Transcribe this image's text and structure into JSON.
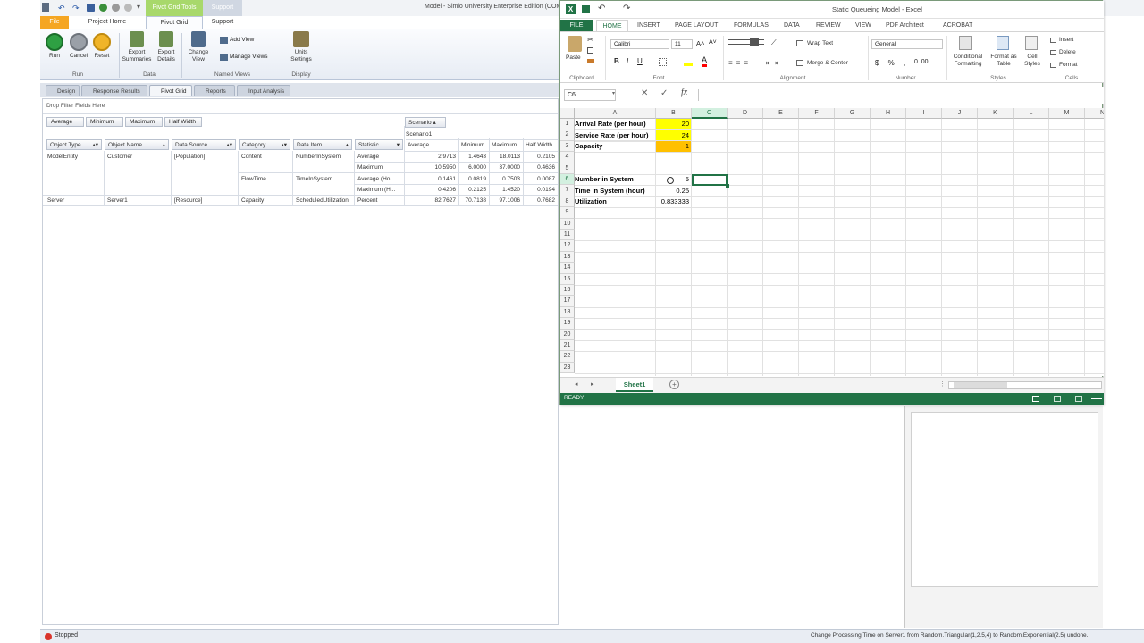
{
  "simio": {
    "window_title": "Model - Simio University Enterprise Edition (COMM",
    "tabs": [
      {
        "label": "File"
      },
      {
        "label": "Project Home"
      },
      {
        "label": "Pivot Grid"
      },
      {
        "label": "Support"
      }
    ],
    "context_tab": "Pivot Grid Tools",
    "context_tab2": "Support",
    "ribbon": {
      "run": {
        "label": "Run"
      },
      "cancel": {
        "label": "Cancel"
      },
      "reset": {
        "label": "Reset"
      },
      "run_group": "Run",
      "export_summaries": "Export Summaries",
      "export_details": "Export Details",
      "data_group": "Data",
      "change_view": "Change View",
      "add_view": "Add View",
      "manage_views": "Manage Views",
      "named_views_group": "Named Views",
      "units_settings": "Units Settings",
      "display_group": "Display"
    },
    "doc_tabs": [
      "Design",
      "Response Results",
      "Pivot Grid",
      "Reports",
      "Input Analysis"
    ],
    "pivot": {
      "drop_filter": "Drop Filter Fields Here",
      "stat_buttons": [
        "Average",
        "Minimum",
        "Maximum",
        "Half Width"
      ],
      "scenario_header": "Scenario",
      "scenario_name": "Scenario1",
      "row_headers": [
        "Object Type",
        "Object Name",
        "Data Source",
        "Category",
        "Data Item",
        "Statistic"
      ],
      "value_headers": [
        "Average",
        "Minimum",
        "Maximum",
        "Half Width"
      ],
      "rows": [
        {
          "object_type": "ModelEntity",
          "object_name": "Customer",
          "data_source": "[Population]",
          "category": "Content",
          "data_item": "NumberInSystem",
          "statistic": "Average",
          "values": [
            "2.9713",
            "1.4643",
            "18.0113",
            "0.2105"
          ]
        },
        {
          "object_type": "",
          "object_name": "",
          "data_source": "",
          "category": "",
          "data_item": "",
          "statistic": "Maximum",
          "values": [
            "10.5950",
            "6.0000",
            "37.0000",
            "0.4636"
          ]
        },
        {
          "object_type": "",
          "object_name": "",
          "data_source": "",
          "category": "FlowTime",
          "data_item": "TimeInSystem",
          "statistic": "Average (Ho...",
          "values": [
            "0.1461",
            "0.0819",
            "0.7503",
            "0.0087"
          ]
        },
        {
          "object_type": "",
          "object_name": "",
          "data_source": "",
          "category": "",
          "data_item": "",
          "statistic": "Maximum (H...",
          "values": [
            "0.4206",
            "0.2125",
            "1.4520",
            "0.0194"
          ]
        },
        {
          "object_type": "Server",
          "object_name": "Server1",
          "data_source": "[Resource]",
          "category": "Capacity",
          "data_item": "ScheduledUtilization",
          "statistic": "Percent",
          "values": [
            "82.7627",
            "70.7138",
            "97.1006",
            "0.7682"
          ]
        }
      ]
    },
    "status_left": "Stopped",
    "status_right": "Change Processing Time on Server1 from Random.Triangular(1,2.5,4) to Random.Exponential(2.5) undone."
  },
  "excel": {
    "title": "Static Queueing Model - Excel",
    "tabs": [
      "FILE",
      "HOME",
      "INSERT",
      "PAGE LAYOUT",
      "FORMULAS",
      "DATA",
      "REVIEW",
      "VIEW",
      "PDF Architect",
      "ACROBAT"
    ],
    "ribbon": {
      "paste": "Paste",
      "clipboard": "Clipboard",
      "font_name": "Calibri",
      "font_size": "11",
      "font_group": "Font",
      "wrap_text": "Wrap Text",
      "merge_center": "Merge & Center",
      "alignment_group": "Alignment",
      "number_format": "General",
      "number_group": "Number",
      "conditional_formatting": "Conditional Formatting",
      "format_as_table": "Format as Table",
      "cell_styles": "Cell Styles",
      "styles_group": "Styles",
      "insert": "Insert",
      "delete": "Delete",
      "format": "Format",
      "cells_group": "Cells"
    },
    "name_box": "C6",
    "formula": "",
    "columns": [
      "A",
      "B",
      "C",
      "D",
      "E",
      "F",
      "G",
      "H",
      "I",
      "J",
      "K",
      "L",
      "M",
      "N"
    ],
    "row_numbers": [
      "1",
      "2",
      "3",
      "4",
      "5",
      "6",
      "7",
      "8",
      "9",
      "10",
      "11",
      "12",
      "13",
      "14",
      "15",
      "16",
      "17",
      "18",
      "19",
      "20",
      "21",
      "22",
      "23"
    ],
    "cells": {
      "A1": "Arrival Rate (per hour)",
      "B1": "20",
      "A2": "Service Rate (per hour)",
      "B2": "24",
      "A3": "Capacity",
      "B3": "1",
      "A6": "Number in System",
      "B6": "5",
      "A7": "Time in System (hour)",
      "B7": "0.25",
      "A8": "Utilization",
      "B8": "0.833333"
    },
    "sheet_tab": "Sheet1",
    "status": "READY",
    "colors": {
      "yellow": "#ffff00",
      "orange": "#ffc000",
      "green": "#217346"
    }
  }
}
